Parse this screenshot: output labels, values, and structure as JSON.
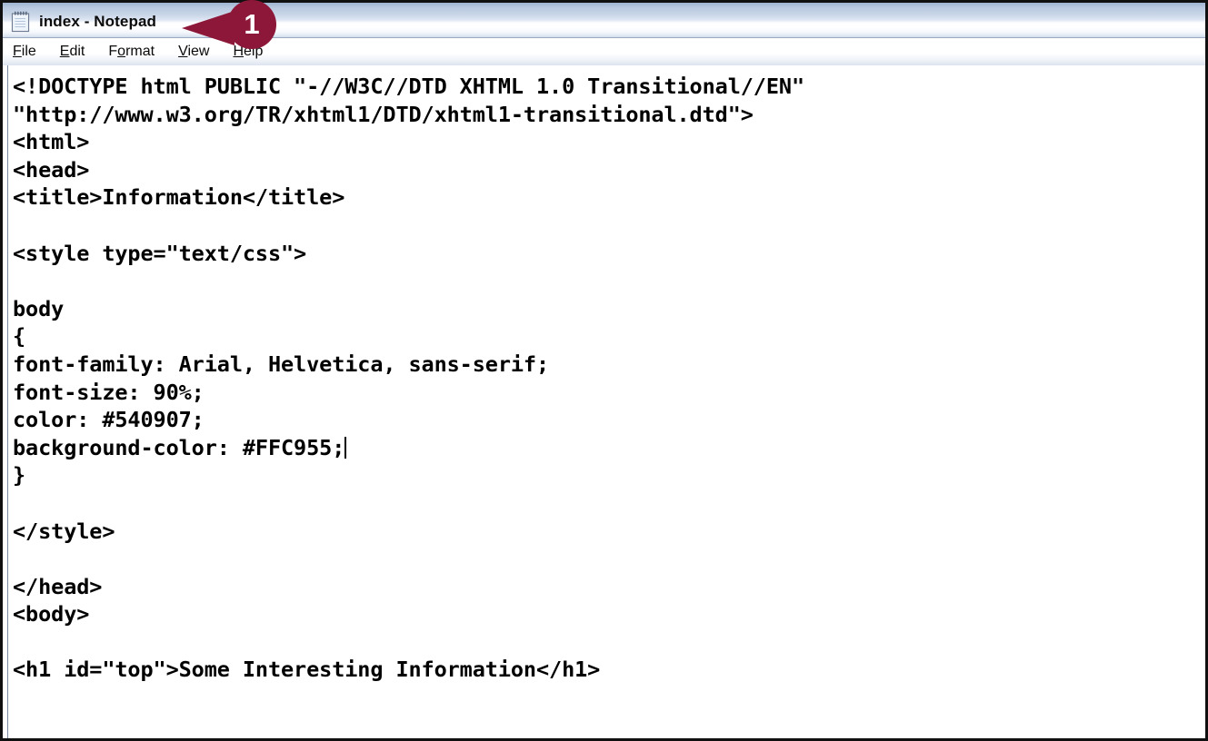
{
  "window": {
    "title": "index - Notepad",
    "icon": "notepad-icon"
  },
  "menubar": {
    "items": [
      {
        "label": "File",
        "accel_index": 0,
        "name": "menu-file"
      },
      {
        "label": "Edit",
        "accel_index": 0,
        "name": "menu-edit"
      },
      {
        "label": "Format",
        "accel_index": 1,
        "name": "menu-format"
      },
      {
        "label": "View",
        "accel_index": 0,
        "name": "menu-view"
      },
      {
        "label": "Help",
        "accel_index": 0,
        "name": "menu-help"
      }
    ]
  },
  "editor": {
    "lines": [
      "<!DOCTYPE html PUBLIC \"-//W3C//DTD XHTML 1.0 Transitional//EN\"",
      "\"http://www.w3.org/TR/xhtml1/DTD/xhtml1-transitional.dtd\">",
      "<html>",
      "<head>",
      "<title>Information</title>",
      "",
      "<style type=\"text/css\">",
      "",
      "body",
      "{",
      "font-family: Arial, Helvetica, sans-serif;",
      "font-size: 90%;",
      "color: #540907;",
      "background-color: #FFC955;",
      "}",
      "",
      "</style>",
      "",
      "</head>",
      "<body>",
      "",
      "<h1 id=\"top\">Some Interesting Information</h1>"
    ],
    "caret_line_index": 13,
    "caret_visible": true
  },
  "callout": {
    "number": "1",
    "color": "#8C1738"
  }
}
